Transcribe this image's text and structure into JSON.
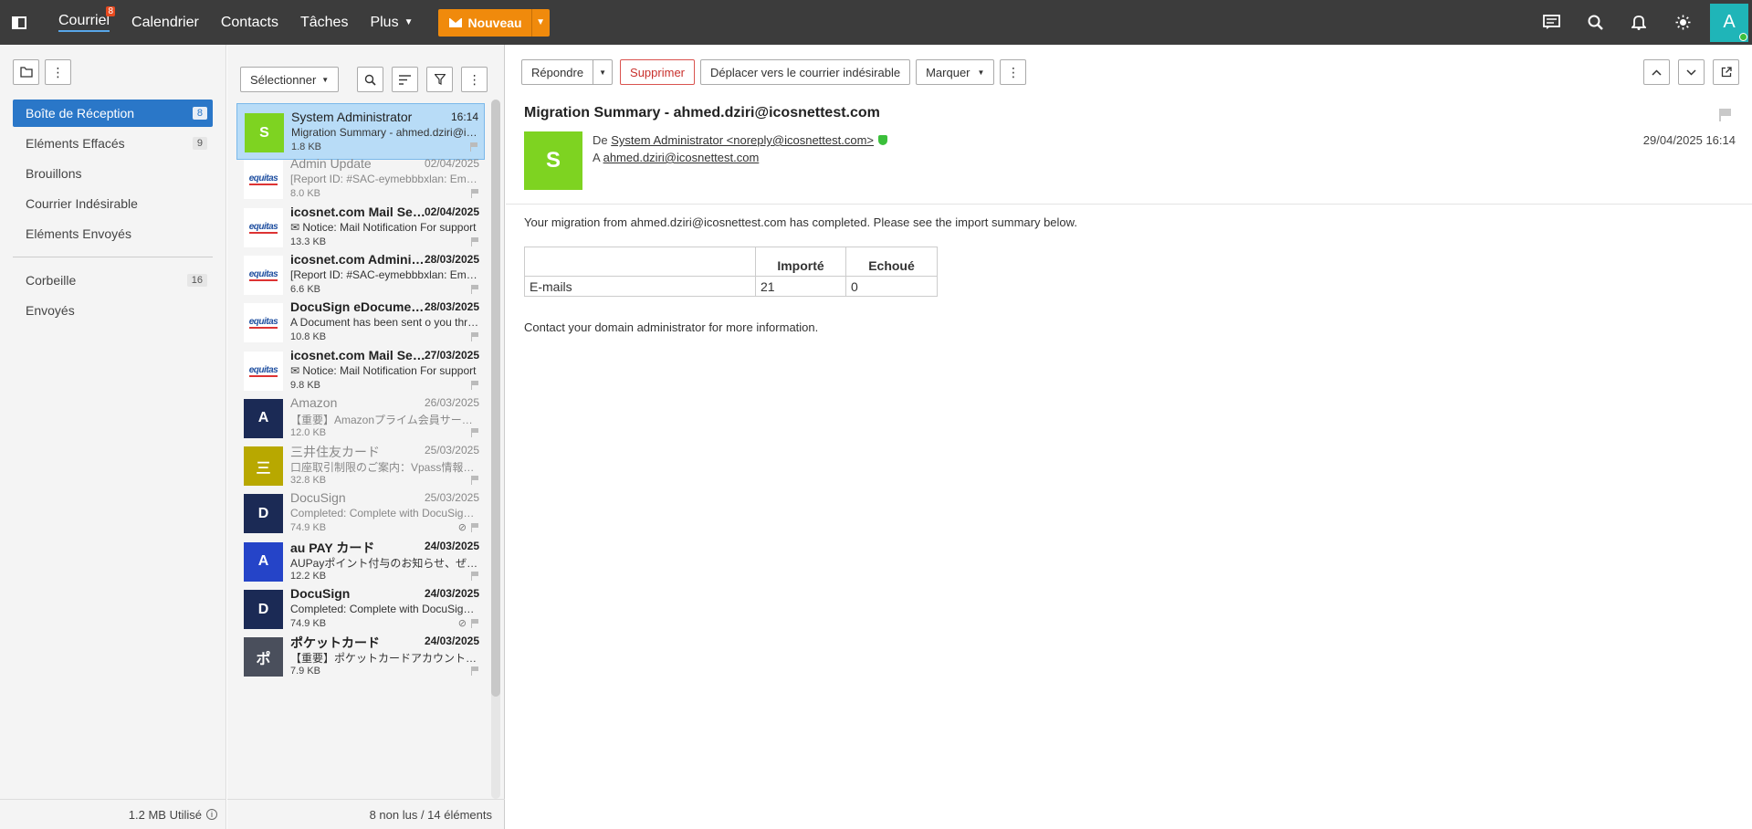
{
  "topbar": {
    "nav": [
      {
        "label": "Courriel",
        "badge": "8",
        "active": true
      },
      {
        "label": "Calendrier"
      },
      {
        "label": "Contacts"
      },
      {
        "label": "Tâches"
      },
      {
        "label": "Plus",
        "caret": true
      }
    ],
    "new_button": "Nouveau",
    "avatar_letter": "A",
    "icons": [
      "chat-icon",
      "search-icon",
      "bell-icon",
      "sun-icon"
    ]
  },
  "sidebar": {
    "folders": [
      {
        "label": "Boîte de Réception",
        "count": "8",
        "active": true
      },
      {
        "label": "Eléments Effacés",
        "count": "9"
      },
      {
        "label": "Brouillons"
      },
      {
        "label": "Courrier Indésirable"
      },
      {
        "label": "Eléments Envoyés"
      }
    ],
    "folders2": [
      {
        "label": "Corbeille",
        "count": "16"
      },
      {
        "label": "Envoyés"
      }
    ],
    "footer": "1.2 MB Utilisé"
  },
  "list": {
    "select_label": "Sélectionner",
    "footer": "8 non lus / 14 éléments",
    "items": [
      {
        "sender": "System Administrator",
        "date": "16:14",
        "subject": "Migration Summary - ahmed.dziri@icosnettest.com",
        "size": "1.8 KB",
        "avatar": "S",
        "color": "#7ed321",
        "state": "selected"
      },
      {
        "sender": "Admin Update",
        "date": "02/04/2025",
        "subject": "[Report ID: #SAC-eymebbbxlan: Email storage full",
        "size": "8.0 KB",
        "avatar": "equitas",
        "state": "read"
      },
      {
        "sender": "icosnet.com Mail Server",
        "date": "02/04/2025",
        "subject": "✉ Notice: Mail Notification For support",
        "size": "13.3 KB",
        "avatar": "equitas",
        "state": "unread"
      },
      {
        "sender": "icosnet.com Administrator",
        "date": "28/03/2025",
        "subject": "[Report ID: #SAC-eymebbbxlan: Email storage full",
        "size": "6.6 KB",
        "avatar": "equitas",
        "state": "unread"
      },
      {
        "sender": "DocuSign eDocuments",
        "date": "28/03/2025",
        "subject": "A Document has been sent o you through DocuSign",
        "size": "10.8 KB",
        "avatar": "equitas",
        "state": "unread"
      },
      {
        "sender": "icosnet.com Mail Server",
        "date": "27/03/2025",
        "subject": "✉ Notice: Mail Notification For support",
        "size": "9.8 KB",
        "avatar": "equitas",
        "state": "unread"
      },
      {
        "sender": "Amazon",
        "date": "26/03/2025",
        "subject": "【重要】Amazonプライム会員サービスのお知らせ",
        "size": "12.0 KB",
        "avatar": "A",
        "color": "#1b2a55",
        "state": "read"
      },
      {
        "sender": "三井住友カード",
        "date": "25/03/2025",
        "subject": "口座取引制限のご案内：Vpass情報のご確認",
        "size": "32.8 KB",
        "avatar": "三",
        "color": "#b8a800",
        "state": "read"
      },
      {
        "sender": "DocuSign",
        "date": "25/03/2025",
        "subject": "Completed: Complete with DocuSign: Document",
        "size": "74.9 KB",
        "avatar": "D",
        "color": "#1b2a55",
        "state": "read",
        "attach": true
      },
      {
        "sender": "au PAY カード",
        "date": "24/03/2025",
        "subject": "AUPayポイント付与のお知らせ、ぜひご確認ください",
        "size": "12.2 KB",
        "avatar": "A",
        "color": "#2544c8",
        "state": "unread"
      },
      {
        "sender": "DocuSign",
        "date": "24/03/2025",
        "subject": "Completed: Complete with DocuSign: Document",
        "size": "74.9 KB",
        "avatar": "D",
        "color": "#1b2a55",
        "state": "unread",
        "attach": true
      },
      {
        "sender": "ポケットカード",
        "date": "24/03/2025",
        "subject": "【重要】ポケットカードアカウントの確認",
        "size": "7.9 KB",
        "avatar": "ポ",
        "color": "#4a4f5c",
        "state": "unread"
      }
    ]
  },
  "reader": {
    "toolbar": {
      "reply": "Répondre",
      "delete": "Supprimer",
      "junk": "Déplacer vers le courrier indésirable",
      "mark": "Marquer"
    },
    "subject": "Migration Summary - ahmed.dziri@icosnettest.com",
    "avatar": "S",
    "from_label": "De",
    "from": "System Administrator <noreply@icosnettest.com>",
    "to_label": "A",
    "to": "ahmed.dziri@icosnettest.com",
    "date": "29/04/2025 16:14",
    "body_intro": "Your migration from ahmed.dziri@icosnettest.com has completed. Please see the import summary below.",
    "table": {
      "col1": "Importé",
      "col2": "Echoué",
      "row_label": "E-mails",
      "imported": "21",
      "failed": "0"
    },
    "body_outro": "Contact your domain administrator for more information."
  }
}
